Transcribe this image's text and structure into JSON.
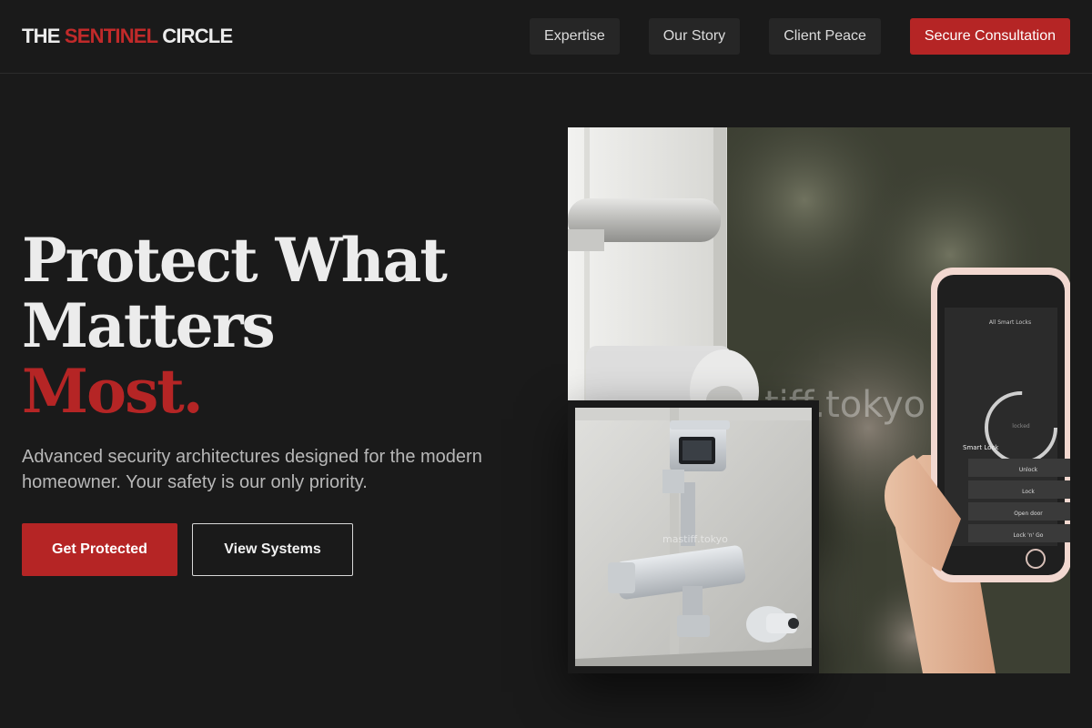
{
  "brand": {
    "part1": "THE ",
    "accent": "SENTINEL",
    "part2": " CIRCLE",
    "accent_color": "#b52525"
  },
  "nav": {
    "items": [
      {
        "label": "Expertise"
      },
      {
        "label": "Our Story"
      },
      {
        "label": "Client Peace"
      }
    ],
    "cta_label": "Secure Consultation"
  },
  "hero": {
    "title_line1": "Protect What",
    "title_line2": "Matters",
    "title_accent": "Most.",
    "subtitle": "Advanced security architectures designed for the modern homeowner. Your safety is our only priority.",
    "primary_button": "Get Protected",
    "secondary_button": "View Systems"
  },
  "images": {
    "main": {
      "watermark": "tiff.tokyo"
    },
    "camera": {
      "watermark": "mastiff.tokyo"
    }
  },
  "phone_app": {
    "title": "All Smart Locks",
    "lock_name": "Smart Lock",
    "status": "locked",
    "buttons": [
      "Unlock",
      "Lock",
      "Open door",
      "Lock 'n' Go"
    ]
  }
}
